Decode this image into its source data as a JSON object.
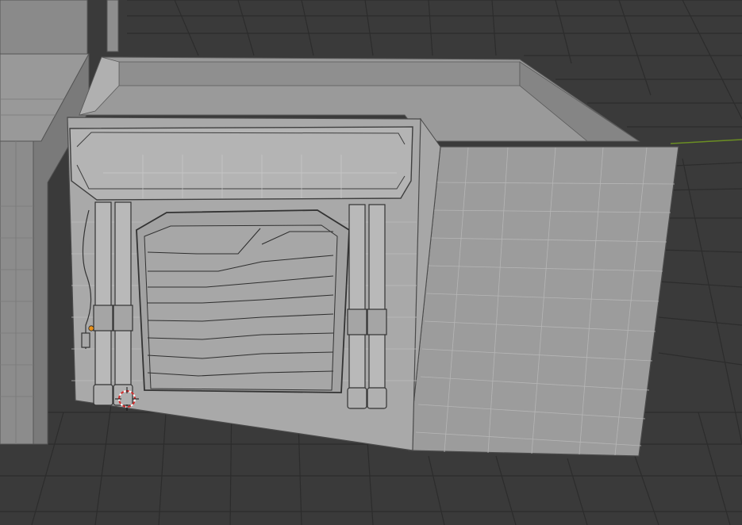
{
  "viewport": {
    "background_color": "#3a3a3a",
    "grid_color": "#2b2b2b",
    "x_axis_color": "#6b8e23",
    "mesh_color": "#8e8e8e",
    "mesh_light_color": "#a0a0a0",
    "mesh_dark_color": "#7f7f7f",
    "edge_color": "#3a3a3a",
    "cursor_color": "#d22b2b",
    "origin_dot_color": "#e8901a"
  },
  "objects": [
    {
      "name": "building-left-background"
    },
    {
      "name": "building-main"
    },
    {
      "name": "garage-door"
    },
    {
      "name": "pillar-pair-left"
    },
    {
      "name": "pillar-pair-right"
    },
    {
      "name": "entrance-header-beam"
    }
  ]
}
